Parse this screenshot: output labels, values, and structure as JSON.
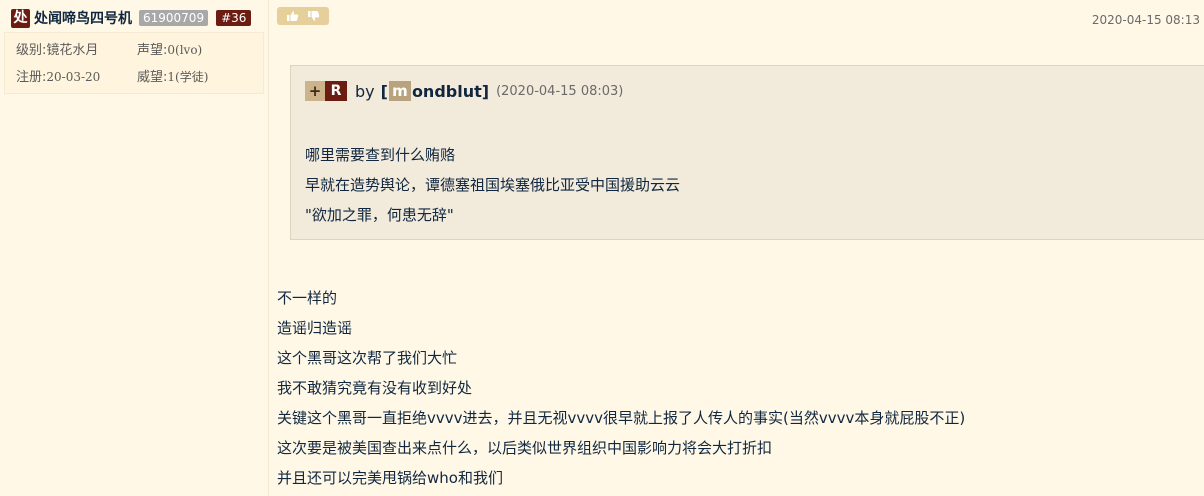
{
  "user": {
    "avatar_char": "处",
    "name": "处闻啼鸟四号机",
    "uid": "61900709",
    "floor": "#36",
    "level_label": "级别:",
    "level_value": "镜花水月",
    "prestige_label": "声望:",
    "prestige_value": "0(lvo)",
    "reg_label": "注册:",
    "reg_value": "20-03-20",
    "reputation_label": "威望:",
    "reputation_value": "1(学徒)"
  },
  "post": {
    "date": "2020-04-15 08:13",
    "like_icon": "thumbs-up-icon",
    "dislike_icon": "thumbs-down-icon"
  },
  "quote": {
    "plus": "+",
    "r": "R",
    "by": "by",
    "user_open": "[",
    "user_initial": "m",
    "user_rest": "ondblut",
    "user_close": "]",
    "date": "(2020-04-15 08:03)",
    "lines": [
      "哪里需要查到什么贿赂",
      "早就在造势舆论，谭德塞祖国埃塞俄比亚受中国援助云云",
      "\"欲加之罪，何患无辞\""
    ]
  },
  "content": {
    "lines": [
      "不一样的",
      "造谣归造谣",
      "这个黑哥这次帮了我们大忙",
      "我不敢猜究竟有没有收到好处",
      "关键这个黑哥一直拒绝vvvv进去，并且无视vvvv很早就上报了人传人的事实(当然vvvv本身就屁股不正)",
      "这次要是被美国查出来点什么，以后类似世界组织中国影响力将会大打折扣",
      "并且还可以完美甩锅给who和我们"
    ]
  }
}
